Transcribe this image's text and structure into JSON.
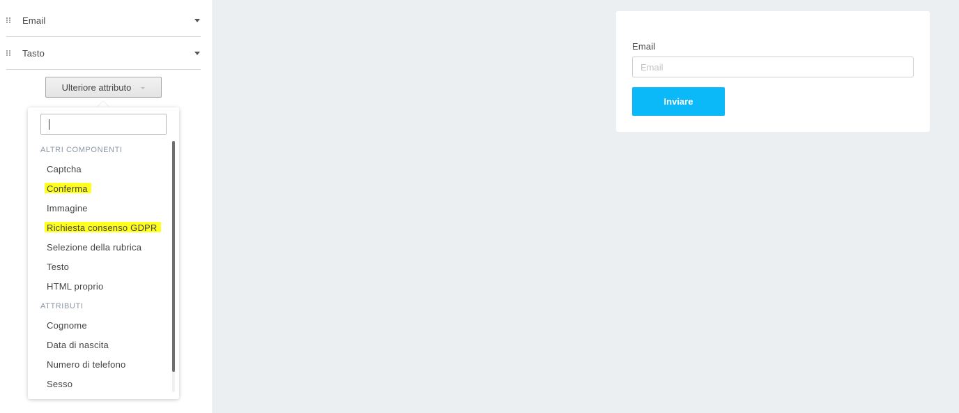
{
  "sidebar": {
    "fields": [
      {
        "label": "Email",
        "icon": "drag-handle-icon"
      },
      {
        "label": "Tasto",
        "icon": "drag-handle-icon"
      }
    ],
    "add_attribute_button": "Ulteriore attributo"
  },
  "dropdown": {
    "search_value": "",
    "groups": [
      {
        "title": "ALTRI COMPONENTI",
        "items": [
          {
            "label": "Captcha",
            "highlighted": false
          },
          {
            "label": "Conferma",
            "highlighted": true
          },
          {
            "label": "Immagine",
            "highlighted": false
          },
          {
            "label": "Richiesta consenso GDPR",
            "highlighted": true
          },
          {
            "label": "Selezione della rubrica",
            "highlighted": false
          },
          {
            "label": "Testo",
            "highlighted": false
          },
          {
            "label": "HTML proprio",
            "highlighted": false
          }
        ]
      },
      {
        "title": "ATTRIBUTI",
        "items": [
          {
            "label": "Cognome",
            "highlighted": false
          },
          {
            "label": "Data di nascita",
            "highlighted": false
          },
          {
            "label": "Numero di telefono",
            "highlighted": false
          },
          {
            "label": "Sesso",
            "highlighted": false
          }
        ]
      }
    ],
    "highlight_color": "#ffff22"
  },
  "form_preview": {
    "email_label": "Email",
    "email_placeholder": "Email",
    "submit_label": "Inviare",
    "submit_color": "#0bb8f8"
  }
}
